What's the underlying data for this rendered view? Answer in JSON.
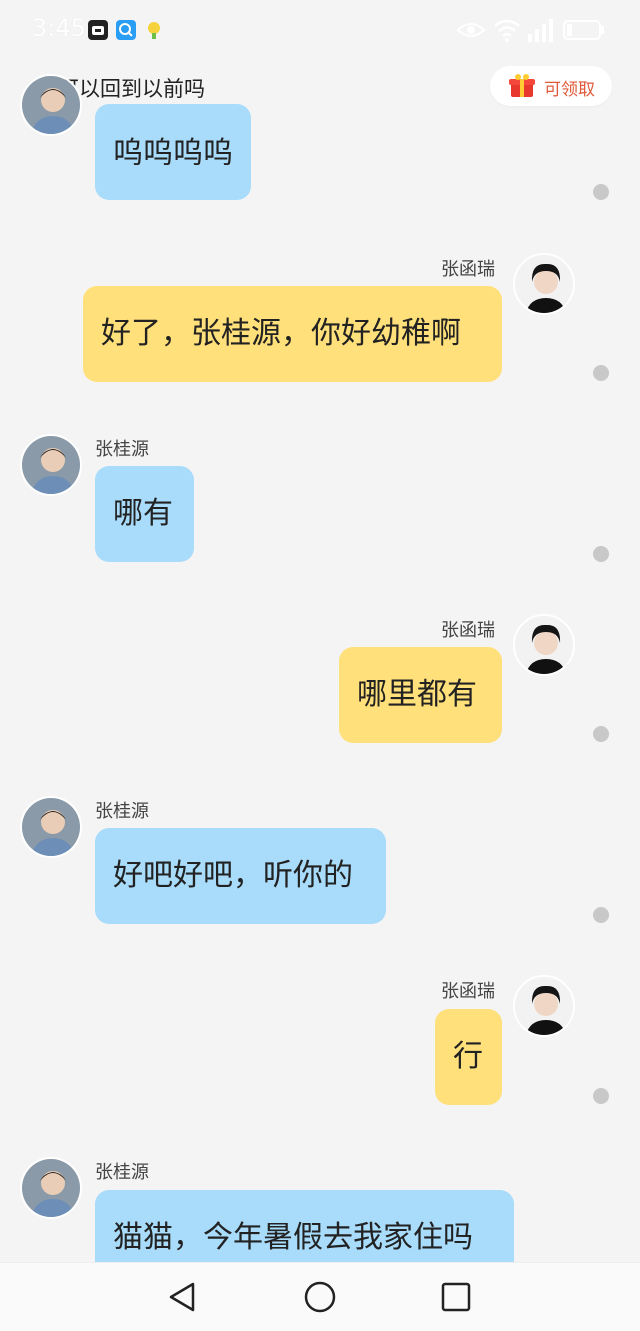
{
  "status_bar": {
    "time": "3:45",
    "battery_icon": "battery-low-icon",
    "wifi_icon": "wifi-icon",
    "signal_icon": "signal-icon",
    "eye_icon": "eye-comfort-icon"
  },
  "header": {
    "title": "可以回到以前吗",
    "back_icon": "chevron-left-icon",
    "claim_label": "可领取",
    "claim_icon": "red-envelope-gift-icon"
  },
  "messages": [
    {
      "side": "left",
      "sender": "",
      "text": "呜呜呜呜"
    },
    {
      "side": "right",
      "sender": "张函瑞",
      "text": "好了，张桂源，你好幼稚啊"
    },
    {
      "side": "left",
      "sender": "张桂源",
      "text": "哪有"
    },
    {
      "side": "right",
      "sender": "张函瑞",
      "text": "哪里都有"
    },
    {
      "side": "left",
      "sender": "张桂源",
      "text": "好吧好吧，听你的"
    },
    {
      "side": "right",
      "sender": "张函瑞",
      "text": "行"
    },
    {
      "side": "left",
      "sender": "张桂源",
      "text": "猫猫，今年暑假去我家住吗"
    }
  ],
  "nav_bar": {
    "back": "triangle-back-icon",
    "home": "circle-home-icon",
    "recents": "square-recents-icon"
  }
}
